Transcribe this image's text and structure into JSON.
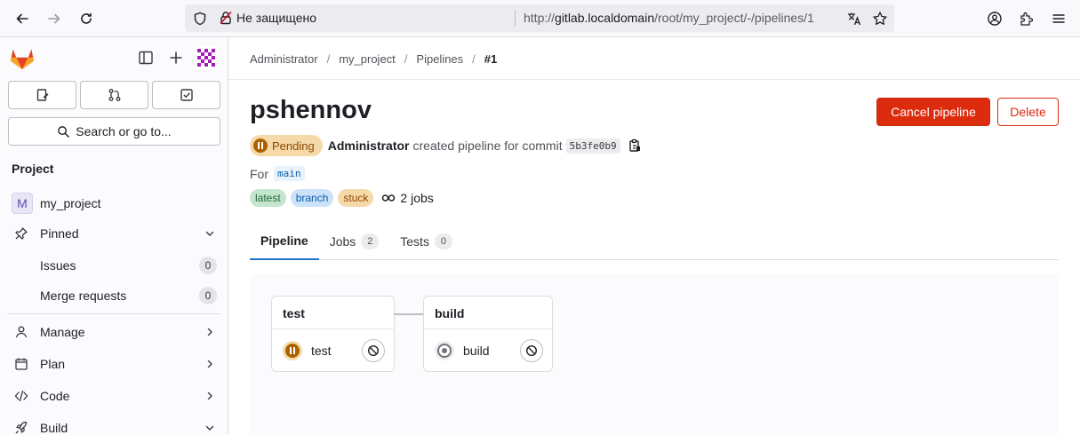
{
  "browser": {
    "insecure_label": "Не защищено",
    "url_prefix": "http://",
    "url_host": "gitlab.localdomain",
    "url_path": "/root/my_project/-/pipelines/1"
  },
  "sidebar": {
    "search_label": "Search or go to...",
    "section_title": "Project",
    "project_name": "my_project",
    "project_initial": "M",
    "pinned_label": "Pinned",
    "pinned_items": [
      {
        "label": "Issues",
        "count": "0"
      },
      {
        "label": "Merge requests",
        "count": "0"
      }
    ],
    "nav_items": [
      {
        "label": "Manage"
      },
      {
        "label": "Plan"
      },
      {
        "label": "Code"
      },
      {
        "label": "Build"
      }
    ]
  },
  "breadcrumb": [
    "Administrator",
    "my_project",
    "Pipelines",
    "#1"
  ],
  "pipeline": {
    "title": "pshennov",
    "status": "Pending",
    "author": "Administrator",
    "action_text": "created pipeline for commit",
    "sha": "5b3fe0b9",
    "for_label": "For",
    "ref": "main",
    "tags": [
      "latest",
      "branch",
      "stuck"
    ],
    "jobs_label": "2 jobs"
  },
  "buttons": {
    "cancel": "Cancel pipeline",
    "delete": "Delete"
  },
  "tabs": [
    {
      "label": "Pipeline"
    },
    {
      "label": "Jobs",
      "count": "2"
    },
    {
      "label": "Tests",
      "count": "0"
    }
  ],
  "stages": [
    {
      "title": "test",
      "job": "test",
      "status": "pending"
    },
    {
      "title": "build",
      "job": "build",
      "status": "created"
    }
  ],
  "colors": {
    "primary_danger": "#dd2b0e",
    "pending_bg": "#f5d9a8",
    "pending_fg": "#ab6100",
    "active_tab": "#1f75cb"
  }
}
